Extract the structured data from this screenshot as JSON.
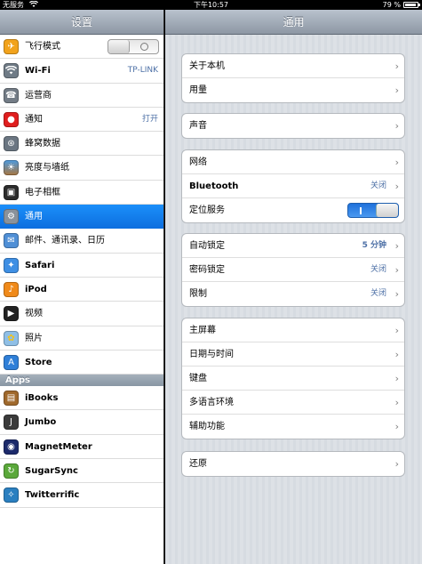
{
  "status_bar": {
    "carrier": "无服务",
    "time": "下午10:57",
    "battery_percent": "79 %"
  },
  "sidebar": {
    "title": "设置",
    "items": [
      {
        "label": "飞行模式",
        "icon": "airplane-icon",
        "value": ""
      },
      {
        "label": "Wi-Fi",
        "icon": "wifi-icon",
        "value": "TP-LINK"
      },
      {
        "label": "运营商",
        "icon": "carrier-phone-icon",
        "value": ""
      },
      {
        "label": "通知",
        "icon": "notification-icon",
        "value": "打开"
      },
      {
        "label": "蜂窝数据",
        "icon": "cellular-icon",
        "value": ""
      },
      {
        "label": "亮度与墙纸",
        "icon": "brightness-icon",
        "value": ""
      },
      {
        "label": "电子相框",
        "icon": "picture-frame-icon",
        "value": ""
      },
      {
        "label": "通用",
        "icon": "gear-icon",
        "value": ""
      },
      {
        "label": "邮件、通讯录、日历",
        "icon": "mail-icon",
        "value": ""
      },
      {
        "label": "Safari",
        "icon": "safari-compass-icon",
        "value": ""
      },
      {
        "label": "iPod",
        "icon": "ipod-icon",
        "value": ""
      },
      {
        "label": "视频",
        "icon": "video-icon",
        "value": ""
      },
      {
        "label": "照片",
        "icon": "photos-flower-icon",
        "value": ""
      },
      {
        "label": "Store",
        "icon": "store-icon",
        "value": ""
      }
    ],
    "apps_header": "Apps",
    "apps": [
      {
        "label": "iBooks",
        "icon": "ibooks-icon"
      },
      {
        "label": "Jumbo",
        "icon": "jumbo-icon"
      },
      {
        "label": "MagnetMeter",
        "icon": "magnetmeter-icon"
      },
      {
        "label": "SugarSync",
        "icon": "sugarsync-icon"
      },
      {
        "label": "Twitterrific",
        "icon": "twitterrific-icon"
      }
    ]
  },
  "main": {
    "title": "通用",
    "groups": [
      [
        {
          "label": "关于本机"
        },
        {
          "label": "用量"
        }
      ],
      [
        {
          "label": "声音"
        }
      ],
      [
        {
          "label": "网络"
        },
        {
          "label": "Bluetooth",
          "value": "关闭"
        },
        {
          "label": "定位服务"
        }
      ],
      [
        {
          "label": "自动锁定",
          "value": "5 分钟"
        },
        {
          "label": "密码锁定",
          "value": "关闭"
        },
        {
          "label": "限制",
          "value": "关闭"
        }
      ],
      [
        {
          "label": "主屏幕"
        },
        {
          "label": "日期与时间"
        },
        {
          "label": "键盘"
        },
        {
          "label": "多语言环境"
        },
        {
          "label": "辅助功能"
        }
      ],
      [
        {
          "label": "还原"
        }
      ]
    ]
  },
  "colors": {
    "selected_row": "#1b8ffa",
    "value_text": "#4d70a6",
    "switch_on": "#1f71db"
  }
}
